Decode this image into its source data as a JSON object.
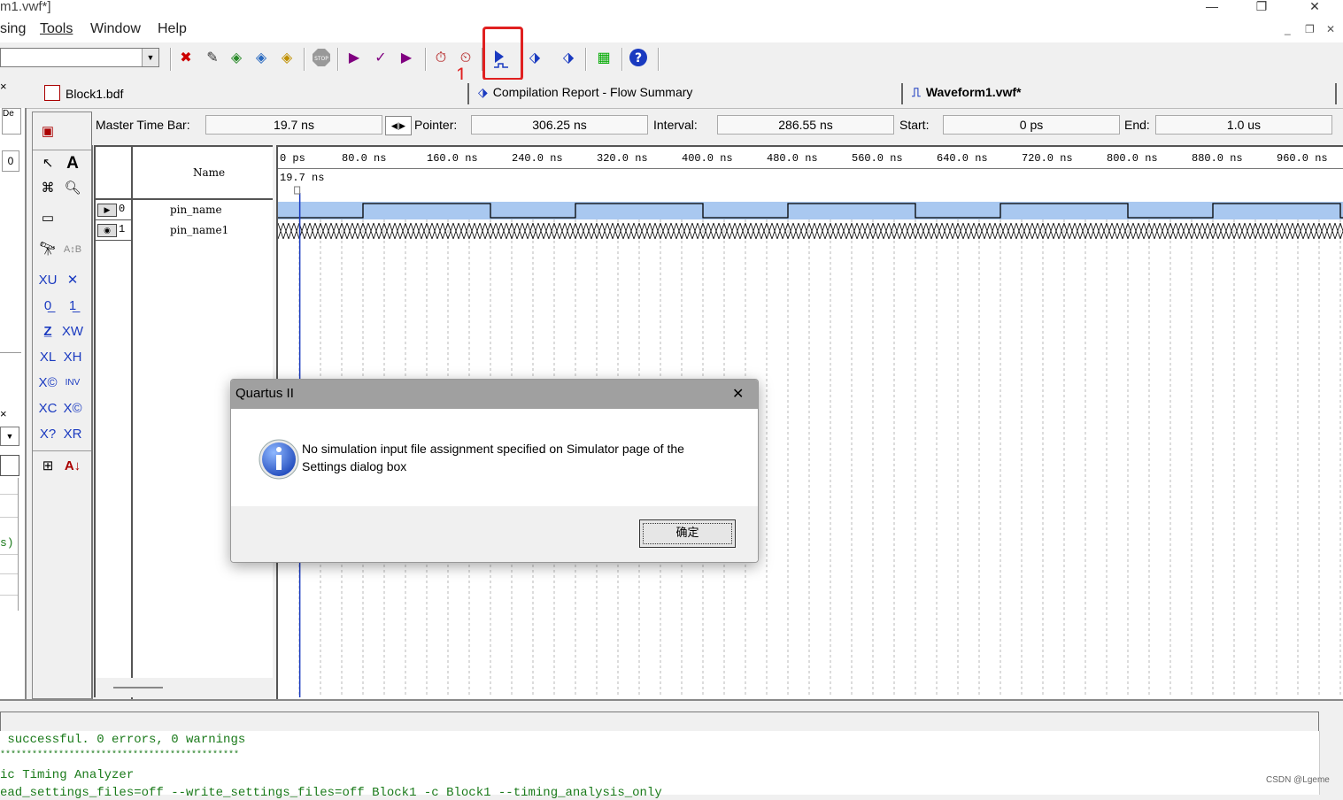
{
  "window": {
    "title": "m1.vwf*]",
    "minimize": "—",
    "restore": "❐",
    "close": "✕"
  },
  "menu": {
    "items": [
      "sing",
      "Tools",
      "Window",
      "Help"
    ],
    "mdi_minimize": "_",
    "mdi_restore": "❐",
    "mdi_close": "✕"
  },
  "toolbar": {
    "combo_value": "",
    "callout": "1",
    "highlighted_tool": "start-simulation-icon"
  },
  "tabs": {
    "block": "Block1.bdf",
    "report": "Compilation Report - Flow Summary",
    "waveform": "Waveform1.vwf*"
  },
  "left_pane": {
    "top_label": "De",
    "value": "0",
    "close_glyph": "×",
    "status_text": "s)"
  },
  "timebar": {
    "master_label": "Master Time Bar:",
    "master_value": "19.7 ns",
    "pointer_label": "Pointer:",
    "pointer_value": "306.25 ns",
    "interval_label": "Interval:",
    "interval_value": "286.55 ns",
    "start_label": "Start:",
    "start_value": "0 ps",
    "end_label": "End:",
    "end_value": "1.0 us"
  },
  "waveform": {
    "name_header": "Name",
    "ruler": [
      "0 ps",
      "80.0 ns",
      "160.0 ns",
      "240.0 ns",
      "320.0 ns",
      "400.0 ns",
      "480.0 ns",
      "560.0 ns",
      "640.0 ns",
      "720.0 ns",
      "800.0 ns",
      "880.0 ns",
      "960.0 ns"
    ],
    "master_marker": "19.7 ns",
    "signals": [
      {
        "index": "0",
        "name": "pin_name",
        "type": "input"
      },
      {
        "index": "1",
        "name": "pin_name1",
        "type": "output"
      }
    ]
  },
  "messages": {
    "lines": [
      " successful. 0 errors, 0 warnings",
      "*********************************************",
      "ic Timing Analyzer",
      "ead_settings_files=off --write_settings_files=off Block1 -c Block1 --timing_analysis_only"
    ],
    "watermark": "CSDN @Lgeme"
  },
  "dialog": {
    "title": "Quartus II",
    "close": "✕",
    "message": "No simulation input file assignment specified on Simulator page of the Settings dialog box",
    "ok_label": "确定",
    "icon": "info-icon"
  }
}
